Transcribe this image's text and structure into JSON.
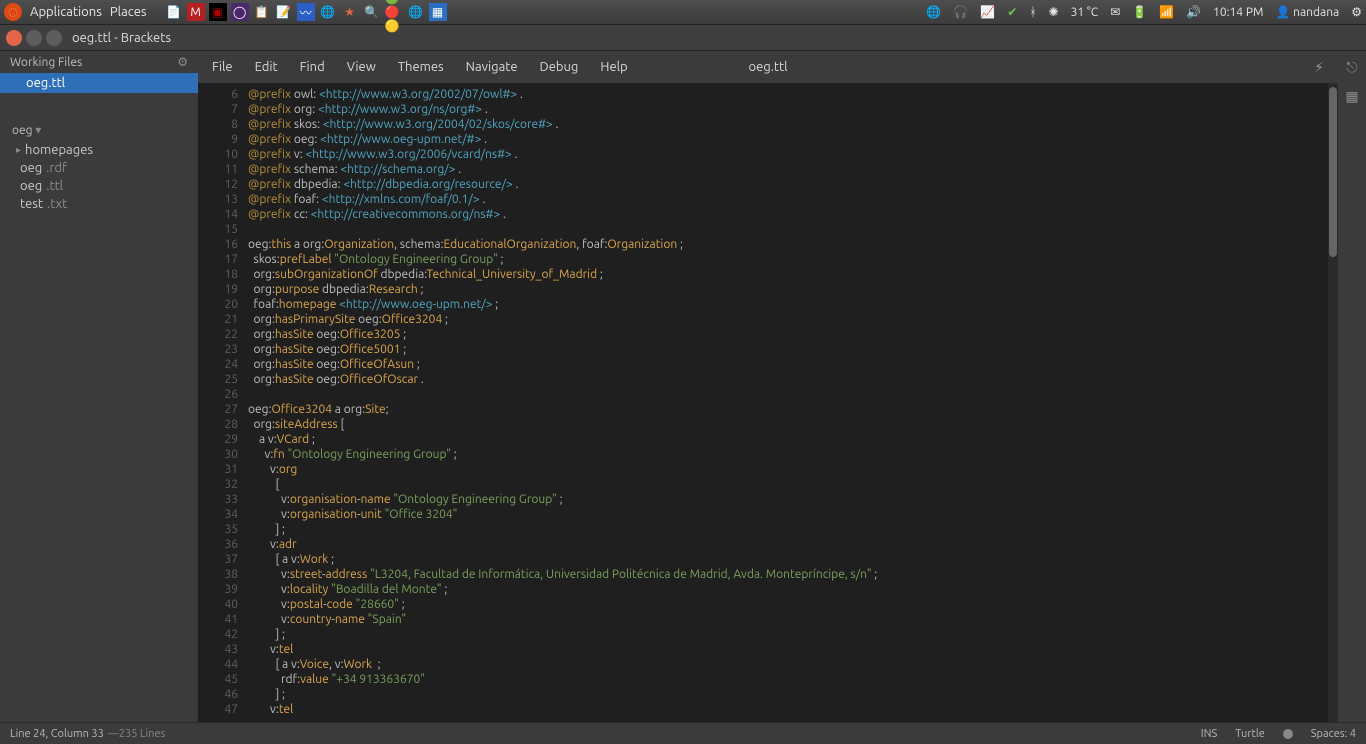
{
  "os_topbar": {
    "menus": [
      "Applications",
      "Places"
    ],
    "temp": "31 °C",
    "time": "10:14 PM",
    "user": "nandana"
  },
  "window": {
    "title": "oeg.ttl - Brackets"
  },
  "sidebar": {
    "working_files_label": "Working Files",
    "working_files": [
      {
        "name": "oeg.ttl",
        "selected": true
      }
    ],
    "project_name": "oeg",
    "project_tree": {
      "folder": "homepages",
      "files": [
        {
          "base": "oeg",
          "ext": ".rdf"
        },
        {
          "base": "oeg",
          "ext": ".ttl"
        },
        {
          "base": "test",
          "ext": ".txt"
        }
      ]
    }
  },
  "menubar": {
    "items": [
      "File",
      "Edit",
      "Find",
      "View",
      "Themes",
      "Navigate",
      "Debug",
      "Help"
    ],
    "doc": "oeg.ttl"
  },
  "statusbar": {
    "pos": "Line 24, Column 33",
    "lines": "235 Lines",
    "ins": "INS",
    "lang": "Turtle",
    "spaces": "Spaces: 4"
  },
  "editor": {
    "first_line_no": 6,
    "lines": [
      [
        [
          "kw",
          "@prefix "
        ],
        [
          "pfx",
          "owl: "
        ],
        [
          "uri",
          "<http://www.w3.org/2002/07/owl#>"
        ],
        [
          "punc",
          " ."
        ]
      ],
      [
        [
          "kw",
          "@prefix "
        ],
        [
          "pfx",
          "org: "
        ],
        [
          "uri",
          "<http://www.w3.org/ns/org#>"
        ],
        [
          "punc",
          " ."
        ]
      ],
      [
        [
          "kw",
          "@prefix "
        ],
        [
          "pfx",
          "skos: "
        ],
        [
          "uri",
          "<http://www.w3.org/2004/02/skos/core#>"
        ],
        [
          "punc",
          " ."
        ]
      ],
      [
        [
          "kw",
          "@prefix "
        ],
        [
          "pfx",
          "oeg: "
        ],
        [
          "uri",
          "<http://www.oeg-upm.net/#>"
        ],
        [
          "punc",
          " ."
        ]
      ],
      [
        [
          "kw",
          "@prefix "
        ],
        [
          "pfx",
          "v: "
        ],
        [
          "uri",
          "<http://www.w3.org/2006/vcard/ns#>"
        ],
        [
          "punc",
          " ."
        ]
      ],
      [
        [
          "kw",
          "@prefix "
        ],
        [
          "pfx",
          "schema: "
        ],
        [
          "uri",
          "<http://schema.org/>"
        ],
        [
          "punc",
          " ."
        ]
      ],
      [
        [
          "kw",
          "@prefix "
        ],
        [
          "pfx",
          "dbpedia: "
        ],
        [
          "uri",
          "<http://dbpedia.org/resource/>"
        ],
        [
          "punc",
          " ."
        ]
      ],
      [
        [
          "kw",
          "@prefix "
        ],
        [
          "pfx",
          "foaf: "
        ],
        [
          "uri",
          "<http://xmlns.com/foaf/0.1/>"
        ],
        [
          "punc",
          " ."
        ]
      ],
      [
        [
          "kw",
          "@prefix "
        ],
        [
          "pfx",
          "cc: "
        ],
        [
          "uri",
          "<http://creativecommons.org/ns#>"
        ],
        [
          "punc",
          " ."
        ]
      ],
      [],
      [
        [
          "pfx",
          "oeg:"
        ],
        [
          "term",
          "this"
        ],
        [
          "pfx",
          " a org:"
        ],
        [
          "term",
          "Organization"
        ],
        [
          "punc",
          ", "
        ],
        [
          "pfx",
          "schema:"
        ],
        [
          "term",
          "EducationalOrganization"
        ],
        [
          "punc",
          ", "
        ],
        [
          "pfx",
          "foaf:"
        ],
        [
          "term",
          "Organization"
        ],
        [
          "punc",
          " ;"
        ]
      ],
      [
        [
          "pfx",
          "  skos:"
        ],
        [
          "term",
          "prefLabel "
        ],
        [
          "str",
          "\"Ontology Engineering Group\""
        ],
        [
          "punc",
          " ;"
        ]
      ],
      [
        [
          "pfx",
          "  org:"
        ],
        [
          "term",
          "subOrganizationOf "
        ],
        [
          "pfx",
          "dbpedia:"
        ],
        [
          "term",
          "Technical_University_of_Madrid"
        ],
        [
          "punc",
          " ;"
        ]
      ],
      [
        [
          "pfx",
          "  org:"
        ],
        [
          "term",
          "purpose "
        ],
        [
          "pfx",
          "dbpedia:"
        ],
        [
          "term",
          "Research"
        ],
        [
          "punc",
          " ;"
        ]
      ],
      [
        [
          "pfx",
          "  foaf:"
        ],
        [
          "term",
          "homepage "
        ],
        [
          "uri",
          "<http://www.oeg-upm.net/>"
        ],
        [
          "punc",
          " ;"
        ]
      ],
      [
        [
          "pfx",
          "  org:"
        ],
        [
          "term",
          "hasPrimarySite "
        ],
        [
          "pfx",
          "oeg:"
        ],
        [
          "term",
          "Office3204"
        ],
        [
          "punc",
          " ;"
        ]
      ],
      [
        [
          "pfx",
          "  org:"
        ],
        [
          "term",
          "hasSite "
        ],
        [
          "pfx",
          "oeg:"
        ],
        [
          "term",
          "Office3205"
        ],
        [
          "punc",
          " ;"
        ]
      ],
      [
        [
          "pfx",
          "  org:"
        ],
        [
          "term",
          "hasSite "
        ],
        [
          "pfx",
          "oeg:"
        ],
        [
          "term",
          "Office5001"
        ],
        [
          "punc",
          " ;"
        ]
      ],
      [
        [
          "pfx",
          "  org:"
        ],
        [
          "term",
          "hasSite "
        ],
        [
          "pfx",
          "oeg:"
        ],
        [
          "term",
          "OfficeOfAsun"
        ],
        [
          "punc",
          " ;"
        ]
      ],
      [
        [
          "pfx",
          "  org:"
        ],
        [
          "term",
          "hasSite "
        ],
        [
          "pfx",
          "oeg:"
        ],
        [
          "term",
          "OfficeOfOscar"
        ],
        [
          "punc",
          " ."
        ]
      ],
      [],
      [
        [
          "pfx",
          "oeg:"
        ],
        [
          "term",
          "Office3204"
        ],
        [
          "pfx",
          " a org:"
        ],
        [
          "term",
          "Site"
        ],
        [
          "punc",
          ";"
        ]
      ],
      [
        [
          "pfx",
          "  org:"
        ],
        [
          "term",
          "siteAddress "
        ],
        [
          "punc",
          "["
        ]
      ],
      [
        [
          "pfx",
          "    a v:"
        ],
        [
          "term",
          "VCard"
        ],
        [
          "punc",
          " ;"
        ]
      ],
      [
        [
          "pfx",
          "      v:"
        ],
        [
          "term",
          "fn "
        ],
        [
          "str",
          "\"Ontology Engineering Group\""
        ],
        [
          "punc",
          " ;"
        ]
      ],
      [
        [
          "pfx",
          "        v:"
        ],
        [
          "term",
          "org"
        ]
      ],
      [
        [
          "punc",
          "          ["
        ]
      ],
      [
        [
          "pfx",
          "            v:"
        ],
        [
          "term",
          "organisation"
        ],
        [
          "punc",
          "-"
        ],
        [
          "term",
          "name "
        ],
        [
          "str",
          "\"Ontology Engineering Group\""
        ],
        [
          "punc",
          " ;"
        ]
      ],
      [
        [
          "pfx",
          "            v:"
        ],
        [
          "term",
          "organisation"
        ],
        [
          "punc",
          "-"
        ],
        [
          "term",
          "unit "
        ],
        [
          "str",
          "\"Office 3204\""
        ]
      ],
      [
        [
          "punc",
          "          ] ;"
        ]
      ],
      [
        [
          "pfx",
          "        v:"
        ],
        [
          "term",
          "adr"
        ]
      ],
      [
        [
          "punc",
          "          [ "
        ],
        [
          "pfx",
          "a v:"
        ],
        [
          "term",
          "Work"
        ],
        [
          "punc",
          " ;"
        ]
      ],
      [
        [
          "pfx",
          "            v:"
        ],
        [
          "term",
          "street"
        ],
        [
          "punc",
          "-"
        ],
        [
          "term",
          "address "
        ],
        [
          "str",
          "\"L3204, Facultad de Informática, Universidad Politécnica de Madrid, Avda. Montepríncipe, s/n\""
        ],
        [
          "punc",
          " ;"
        ]
      ],
      [
        [
          "pfx",
          "            v:"
        ],
        [
          "term",
          "locality "
        ],
        [
          "str",
          "\"Boadilla del Monte\""
        ],
        [
          "punc",
          " ;"
        ]
      ],
      [
        [
          "pfx",
          "            v:"
        ],
        [
          "term",
          "postal"
        ],
        [
          "punc",
          "-"
        ],
        [
          "term",
          "code "
        ],
        [
          "str",
          "\"28660\""
        ],
        [
          "punc",
          " ;"
        ]
      ],
      [
        [
          "pfx",
          "            v:"
        ],
        [
          "term",
          "country"
        ],
        [
          "punc",
          "-"
        ],
        [
          "term",
          "name "
        ],
        [
          "str",
          "\"Spain\""
        ]
      ],
      [
        [
          "punc",
          "          ] ;"
        ]
      ],
      [
        [
          "pfx",
          "        v:"
        ],
        [
          "term",
          "tel"
        ]
      ],
      [
        [
          "punc",
          "          [ "
        ],
        [
          "pfx",
          "a v:"
        ],
        [
          "term",
          "Voice"
        ],
        [
          "punc",
          ", "
        ],
        [
          "pfx",
          "v:"
        ],
        [
          "term",
          "Work"
        ],
        [
          "punc",
          "  ;"
        ]
      ],
      [
        [
          "pfx",
          "            rdf:"
        ],
        [
          "term",
          "value "
        ],
        [
          "str",
          "\"+34 913363670\""
        ]
      ],
      [
        [
          "punc",
          "          ] ;"
        ]
      ],
      [
        [
          "pfx",
          "        v:"
        ],
        [
          "term",
          "tel"
        ]
      ]
    ]
  }
}
